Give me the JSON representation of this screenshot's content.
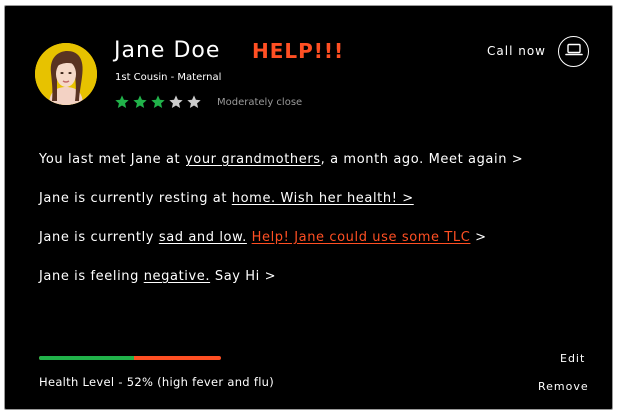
{
  "contact": {
    "name": "Jane Doe",
    "alert": "HELP!!!",
    "relation": "1st Cousin - Maternal",
    "rating": 3,
    "rating_max": 5,
    "closeness": "Moderately close"
  },
  "call": {
    "label": "Call now",
    "icon": "laptop-icon"
  },
  "messages": {
    "line1": {
      "pre": "You last met Jane at ",
      "link": "your grandmothers",
      "post": ", a month ago. Meet again >"
    },
    "line2": {
      "pre": "Jane is currently resting at ",
      "link": "home. Wish her health! >"
    },
    "line3": {
      "pre": "Jane is currently ",
      "link": "sad and low.",
      "alert_link": "Help! Jane could use some TLC",
      "post": " >"
    },
    "line4": {
      "pre": "Jane is feeling ",
      "link": "negative.",
      "post": " Say Hi >"
    }
  },
  "health": {
    "level": 0.52,
    "label": "Health Level - 52% (high fever and flu)"
  },
  "actions": {
    "edit": "Edit",
    "remove": "Remove"
  },
  "colors": {
    "background": "#000000",
    "accent": "#ff4f23",
    "good": "#21b24a",
    "star_on": "#21b24a",
    "star_off": "#cccccc",
    "avatar_bg": "#e7c200"
  }
}
